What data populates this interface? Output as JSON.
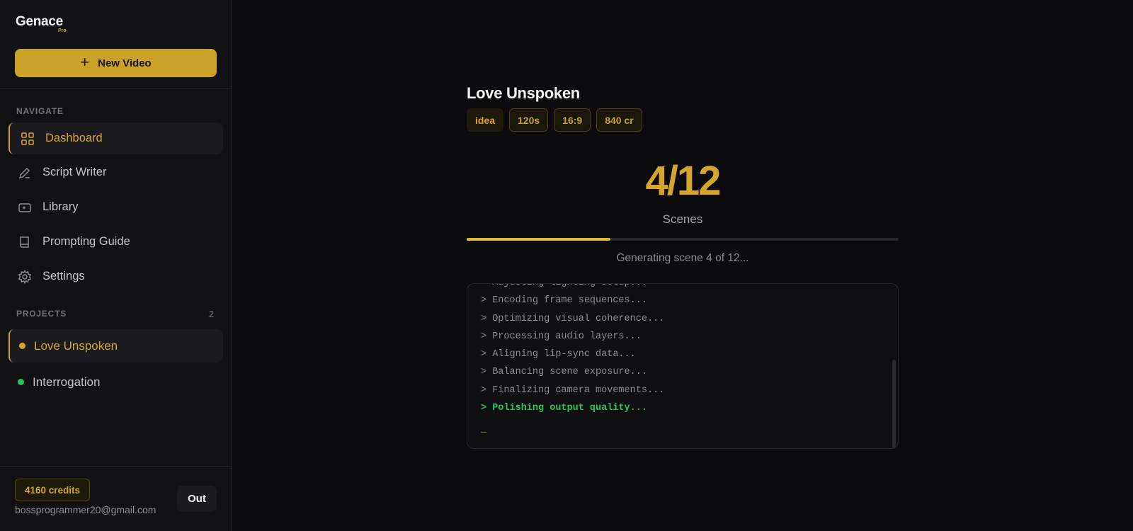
{
  "brand": {
    "name": "Genace",
    "tier": "Pro"
  },
  "sidebar": {
    "new_video_label": "New Video",
    "navigate_label": "NAVIGATE",
    "nav_items": [
      {
        "label": "Dashboard",
        "icon": "grid-icon",
        "active": true
      },
      {
        "label": "Script Writer",
        "icon": "pen-icon",
        "active": false
      },
      {
        "label": "Library",
        "icon": "library-icon",
        "active": false
      },
      {
        "label": "Prompting Guide",
        "icon": "book-icon",
        "active": false
      },
      {
        "label": "Settings",
        "icon": "gear-icon",
        "active": false
      }
    ],
    "projects_label": "PROJECTS",
    "projects_count": "2",
    "projects": [
      {
        "label": "Love Unspoken",
        "status_color": "#d4a72c",
        "active": true
      },
      {
        "label": "Interrogation",
        "status_color": "#22c55e",
        "active": false
      }
    ],
    "credits": "4160 credits",
    "email": "bossprogrammer20@gmail.com",
    "out_label": "Out"
  },
  "main": {
    "project_title": "Love Unspoken",
    "tags": [
      "idea",
      "120s",
      "16:9",
      "840 cr"
    ],
    "counter": "4/12",
    "counter_label": "Scenes",
    "progress_fraction": 0.333,
    "status_text": "Generating scene 4 of 12...",
    "log_lines": [
      "> Adjusting lighting setup...",
      "> Encoding frame sequences...",
      "> Optimizing visual coherence...",
      "> Processing audio layers...",
      "> Aligning lip-sync data...",
      "> Balancing scene exposure...",
      "> Finalizing camera movements...",
      "> Polishing output quality..."
    ],
    "cursor": "_"
  },
  "colors": {
    "accent": "#c9a227",
    "background": "#0b0b0d",
    "sidebar": "#121215",
    "success": "#22c55e"
  }
}
